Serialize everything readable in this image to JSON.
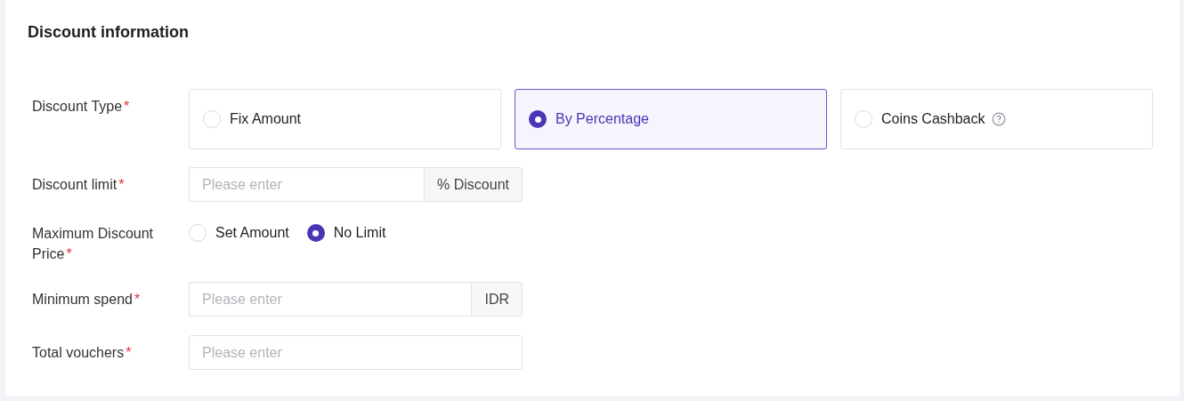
{
  "section": {
    "title": "Discount information"
  },
  "fields": [
    {
      "kind": "cards",
      "label": "Discount Type",
      "mark": "*",
      "options": [
        {
          "label": "Fix Amount",
          "selected": false,
          "help": false
        },
        {
          "label": "By Percentage",
          "selected": true,
          "help": false
        },
        {
          "label": "Coins Cashback",
          "selected": false,
          "help": true
        }
      ]
    },
    {
      "kind": "input",
      "label": "Discount limit",
      "mark": "*",
      "placeholder": "Please enter",
      "suffix": "% Discount"
    },
    {
      "kind": "radios",
      "label": "Maximum Discount Price",
      "mark": "*",
      "options": [
        {
          "label": "Set Amount",
          "selected": false
        },
        {
          "label": "No Limit",
          "selected": true
        }
      ]
    },
    {
      "kind": "input",
      "label": "Minimum spend",
      "mark": "*",
      "placeholder": "Please enter",
      "suffix": "IDR"
    },
    {
      "kind": "input",
      "label": "Total vouchers",
      "mark": "*",
      "placeholder": "Please enter"
    }
  ]
}
